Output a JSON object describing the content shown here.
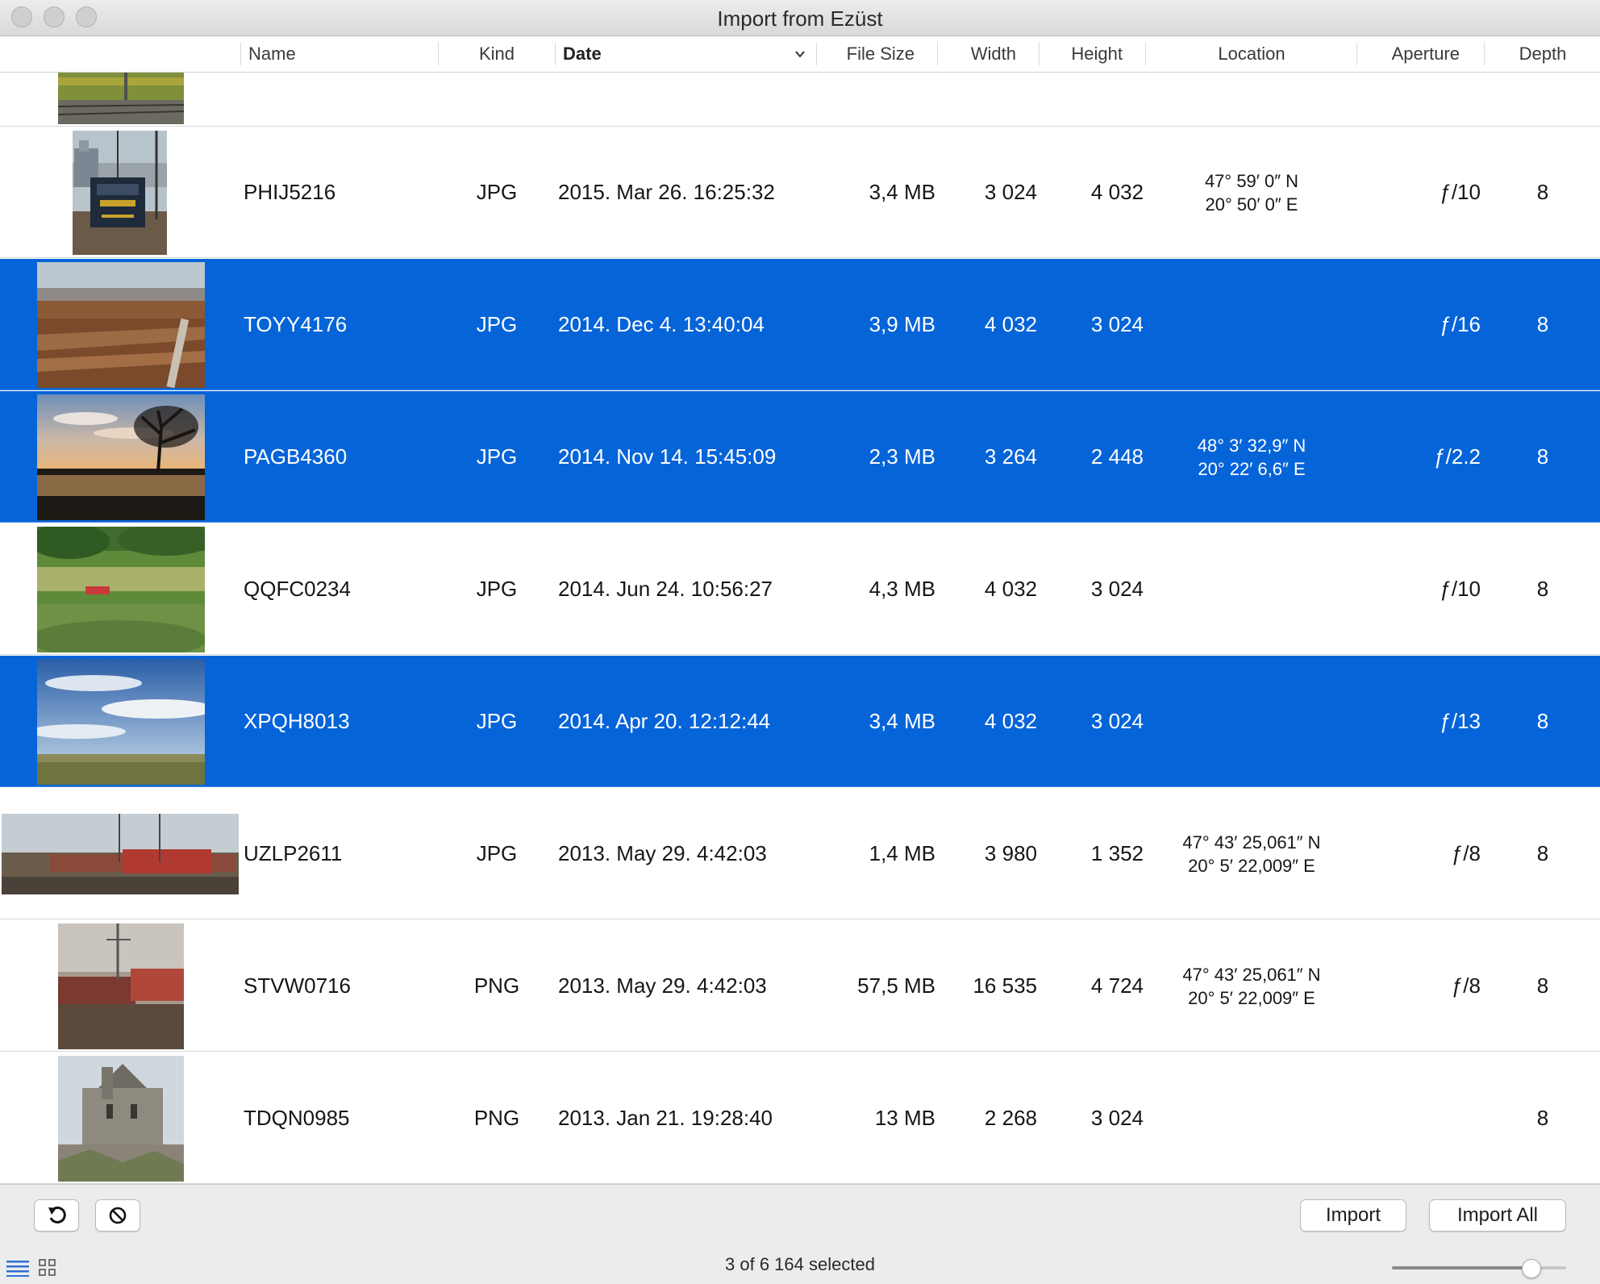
{
  "window": {
    "title": "Import from Ezüst"
  },
  "columns": {
    "name": "Name",
    "kind": "Kind",
    "date": "Date",
    "file_size": "File Size",
    "width": "Width",
    "height": "Height",
    "location": "Location",
    "aperture": "Aperture",
    "depth": "Depth",
    "sorted_by": "Date",
    "sort_direction": "descending"
  },
  "rows": [
    {
      "name": "PHIJ5216",
      "kind": "JPG",
      "date": "2015. Mar 26. 16:25:32",
      "size": "3,4 MB",
      "width": "3 024",
      "height": "4 032",
      "location_lat": "47° 59′ 0″ N",
      "location_lon": "20° 50′ 0″ E",
      "aperture": "ƒ/10",
      "depth": "8",
      "selected": false,
      "thumb": "electric-locomotive-photo"
    },
    {
      "name": "TOYY4176",
      "kind": "JPG",
      "date": "2014. Dec 4. 13:40:04",
      "size": "3,9 MB",
      "width": "4 032",
      "height": "3 024",
      "location_lat": "",
      "location_lon": "",
      "aperture": "ƒ/16",
      "depth": "8",
      "selected": true,
      "thumb": "vineyard-photo"
    },
    {
      "name": "PAGB4360",
      "kind": "JPG",
      "date": "2014. Nov 14. 15:45:09",
      "size": "2,3 MB",
      "width": "3 264",
      "height": "2 448",
      "location_lat": "48° 3′ 32,9″ N",
      "location_lon": "20° 22′ 6,6″ E",
      "aperture": "ƒ/2.2",
      "depth": "8",
      "selected": true,
      "thumb": "sunset-lake-photo"
    },
    {
      "name": "QQFC0234",
      "kind": "JPG",
      "date": "2014. Jun 24. 10:56:27",
      "size": "4,3 MB",
      "width": "4 032",
      "height": "3 024",
      "location_lat": "",
      "location_lon": "",
      "aperture": "ƒ/10",
      "depth": "8",
      "selected": false,
      "thumb": "green-field-train-photo"
    },
    {
      "name": "XPQH8013",
      "kind": "JPG",
      "date": "2014. Apr 20. 12:12:44",
      "size": "3,4 MB",
      "width": "4 032",
      "height": "3 024",
      "location_lat": "",
      "location_lon": "",
      "aperture": "ƒ/13",
      "depth": "8",
      "selected": true,
      "thumb": "cloudy-sky-photo"
    },
    {
      "name": "UZLP2611",
      "kind": "JPG",
      "date": "2013. May 29. 4:42:03",
      "size": "1,4 MB",
      "width": "3 980",
      "height": "1 352",
      "location_lat": "47° 43′ 25,061″ N",
      "location_lon": "20° 5′ 22,009″ E",
      "aperture": "ƒ/8",
      "depth": "8",
      "selected": false,
      "thumb": "red-train-panorama-photo"
    },
    {
      "name": "STVW0716",
      "kind": "PNG",
      "date": "2013. May 29. 4:42:03",
      "size": "57,5 MB",
      "width": "16 535",
      "height": "4 724",
      "location_lat": "47° 43′ 25,061″ N",
      "location_lon": "20° 5′ 22,009″ E",
      "aperture": "ƒ/8",
      "depth": "8",
      "selected": false,
      "thumb": "red-train-freight-photo"
    },
    {
      "name": "TDQN0985",
      "kind": "PNG",
      "date": "2013. Jan 21. 19:28:40",
      "size": "13 MB",
      "width": "2 268",
      "height": "3 024",
      "location_lat": "",
      "location_lon": "",
      "aperture": "",
      "depth": "8",
      "selected": false,
      "thumb": "stone-church-photo"
    }
  ],
  "footer": {
    "import_label": "Import",
    "import_all_label": "Import All",
    "status": "3 of 6 164 selected",
    "rotate_icon": "rotate-left-icon",
    "delete_icon": "prohibit-icon",
    "list_view_icon": "list-view-icon",
    "grid_view_icon": "grid-view-icon",
    "thumbnail_size": 0.8
  },
  "colors": {
    "selection": "#0664d9",
    "header_text": "#3a3a3a"
  }
}
